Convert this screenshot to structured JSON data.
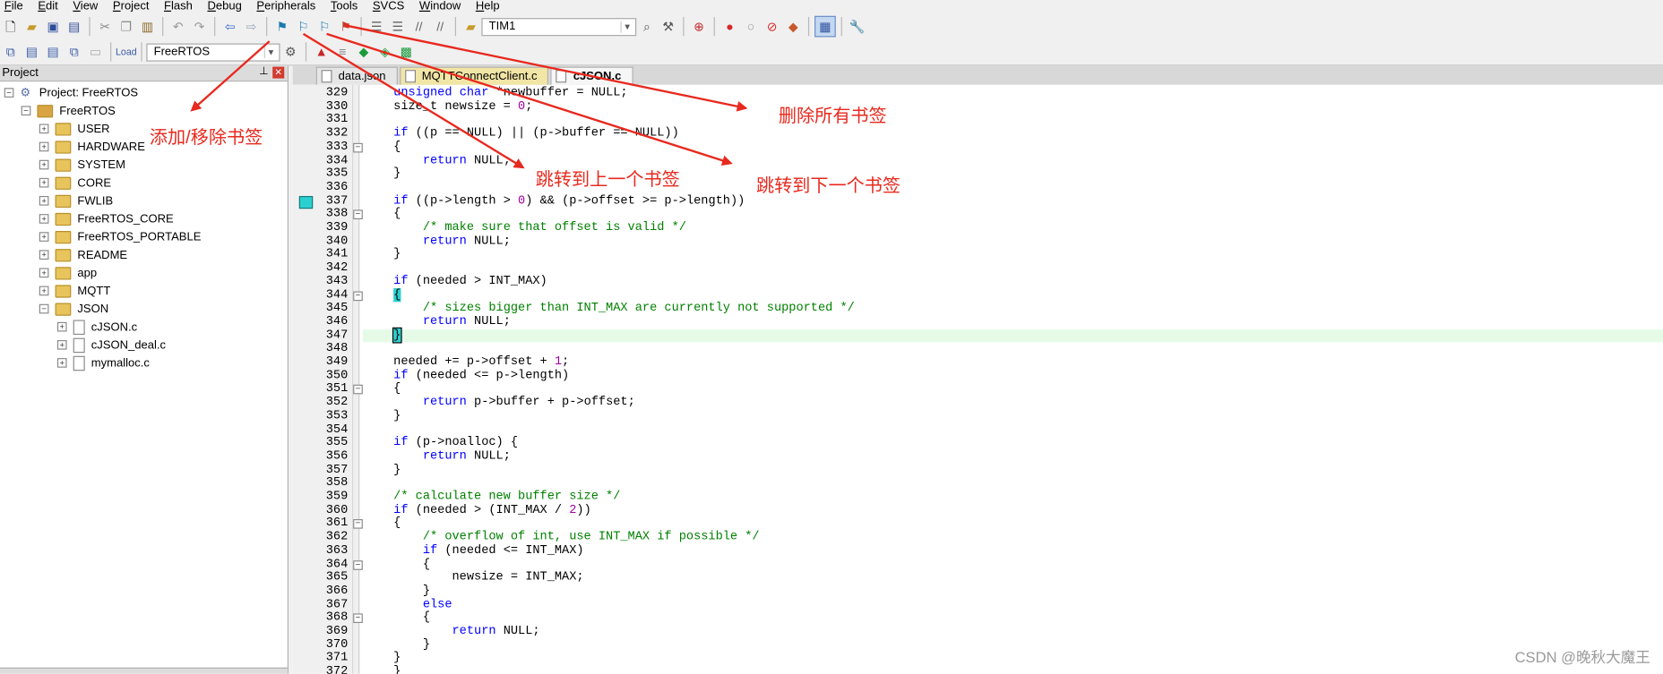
{
  "menu": [
    "File",
    "Edit",
    "View",
    "Project",
    "Flash",
    "Debug",
    "Peripherals",
    "Tools",
    "SVCS",
    "Window",
    "Help"
  ],
  "toolbar": {
    "target_combo": "TIM1",
    "project_combo": "FreeRTOS",
    "load_label": "Load"
  },
  "project_pane": {
    "title": "Project",
    "root_label": "Project: FreeRTOS",
    "target_label": "FreeRTOS",
    "groups": [
      "USER",
      "HARDWARE",
      "SYSTEM",
      "CORE",
      "FWLIB",
      "FreeRTOS_CORE",
      "FreeRTOS_PORTABLE",
      "README",
      "app",
      "MQTT",
      "JSON"
    ],
    "json_files": [
      "cJSON.c",
      "cJSON_deal.c",
      "mymalloc.c"
    ]
  },
  "editor": {
    "tabs": [
      "data.json",
      "MQTTConnectClient.c",
      "cJSON.c"
    ],
    "line_numbers": [
      "329",
      "330",
      "331",
      "332",
      "333",
      "334",
      "335",
      "336",
      "337",
      "338",
      "339",
      "340",
      "341",
      "342",
      "343",
      "344",
      "345",
      "346",
      "347",
      "348",
      "349",
      "350",
      "351",
      "352",
      "353",
      "354",
      "355",
      "356",
      "357",
      "358",
      "359",
      "360",
      "361",
      "362",
      "363",
      "364",
      "365",
      "366",
      "367",
      "368",
      "369",
      "370",
      "371",
      "372"
    ]
  },
  "annotations": {
    "add_remove": "添加/移除书签",
    "delete_all": "删除所有书签",
    "prev": "跳转到上一个书签",
    "next": "跳转到下一个书签"
  },
  "watermark": "CSDN @晚秋大魔王",
  "colors": {
    "annotation": "#e8291e",
    "bookmark": "#2ad0d0",
    "current_line": "#e5fbe7",
    "keyword": "#0000ff",
    "comment": "#008000"
  }
}
